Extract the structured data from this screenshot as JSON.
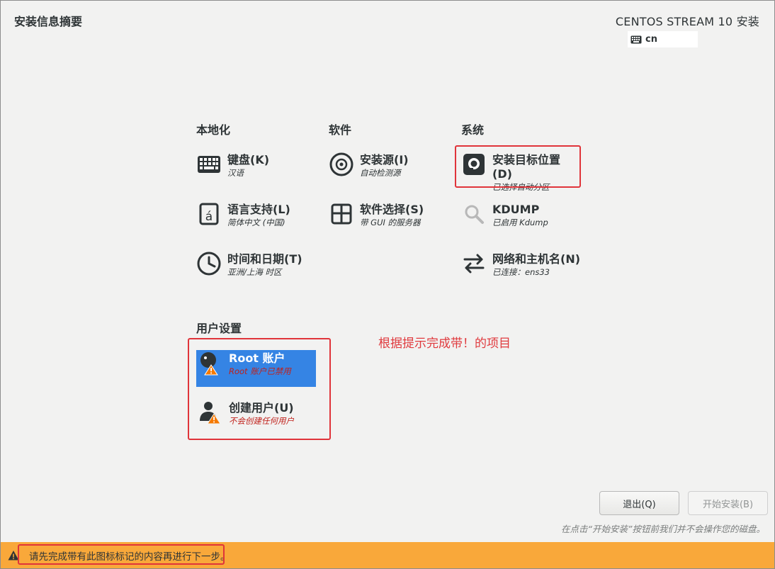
{
  "header": {
    "title": "安装信息摘要",
    "product": "CENTOS STREAM 10 安装",
    "keyboard_layout": "cn"
  },
  "sections": {
    "localization": "本地化",
    "software": "软件",
    "system": "系统",
    "user_settings": "用户设置"
  },
  "spokes": {
    "keyboard": {
      "title": "键盘(K)",
      "status": "汉语",
      "icon": "keyboard-icon"
    },
    "language": {
      "title": "语言支持(L)",
      "status": "简体中文 (中国)",
      "icon": "language-icon"
    },
    "datetime": {
      "title": "时间和日期(T)",
      "status": "亚洲/上海 时区",
      "icon": "clock-icon"
    },
    "source": {
      "title": "安装源(I)",
      "status": "自动检测源",
      "icon": "disc-icon"
    },
    "software_selection": {
      "title": "软件选择(S)",
      "status": "带 GUI 的服务器",
      "icon": "package-icon"
    },
    "destination": {
      "title": "安装目标位置(D)",
      "status": "已选择自动分区",
      "icon": "harddisk-icon"
    },
    "kdump": {
      "title": "KDUMP",
      "status": "已启用 Kdump",
      "icon": "magnifier-icon"
    },
    "network": {
      "title": "网络和主机名(N)",
      "status": "已连接：ens33",
      "icon": "network-arrows-icon"
    },
    "root": {
      "title": "Root 账户",
      "status": "Root 账户已禁用",
      "icon": "root-user-warning-icon"
    },
    "user": {
      "title": "创建用户(U)",
      "status": "不会创建任何用户",
      "icon": "user-warning-icon"
    }
  },
  "annotation": "根据提示完成带！的项目",
  "buttons": {
    "quit": "退出(Q)",
    "begin": "开始安装(B)"
  },
  "disk_note": "在点击“开始安装”按钮前我们并不会操作您的磁盘。",
  "warning_bar": "请先完成带有此图标标记的内容再进行下一步。",
  "colors": {
    "selected": "#3584e4",
    "warning_bar": "#f9a83a",
    "annotation_red": "#e0343a",
    "status_warning": "#c0201a"
  }
}
